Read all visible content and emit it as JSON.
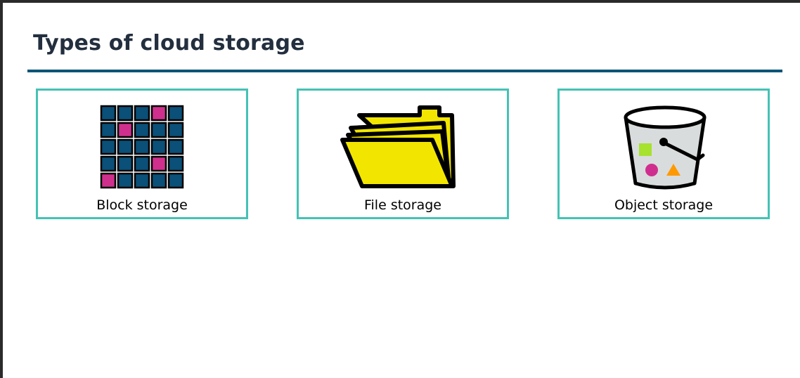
{
  "page": {
    "title": "Types of cloud storage"
  },
  "cards": [
    {
      "label": "Block storage",
      "icon": "block-grid-icon"
    },
    {
      "label": "File storage",
      "icon": "folder-icon"
    },
    {
      "label": "Object storage",
      "icon": "bucket-icon"
    }
  ],
  "colors": {
    "title": "#232f3e",
    "rule": "#0b5578",
    "card_border": "#45c2b5",
    "block_blue": "#0a5078",
    "block_pink": "#d0308d",
    "folder_yellow": "#f2e600",
    "bucket_fill": "#d9dcdd",
    "shape_green": "#a6e22e",
    "shape_magenta": "#d02e8e",
    "shape_orange": "#ff9900"
  }
}
